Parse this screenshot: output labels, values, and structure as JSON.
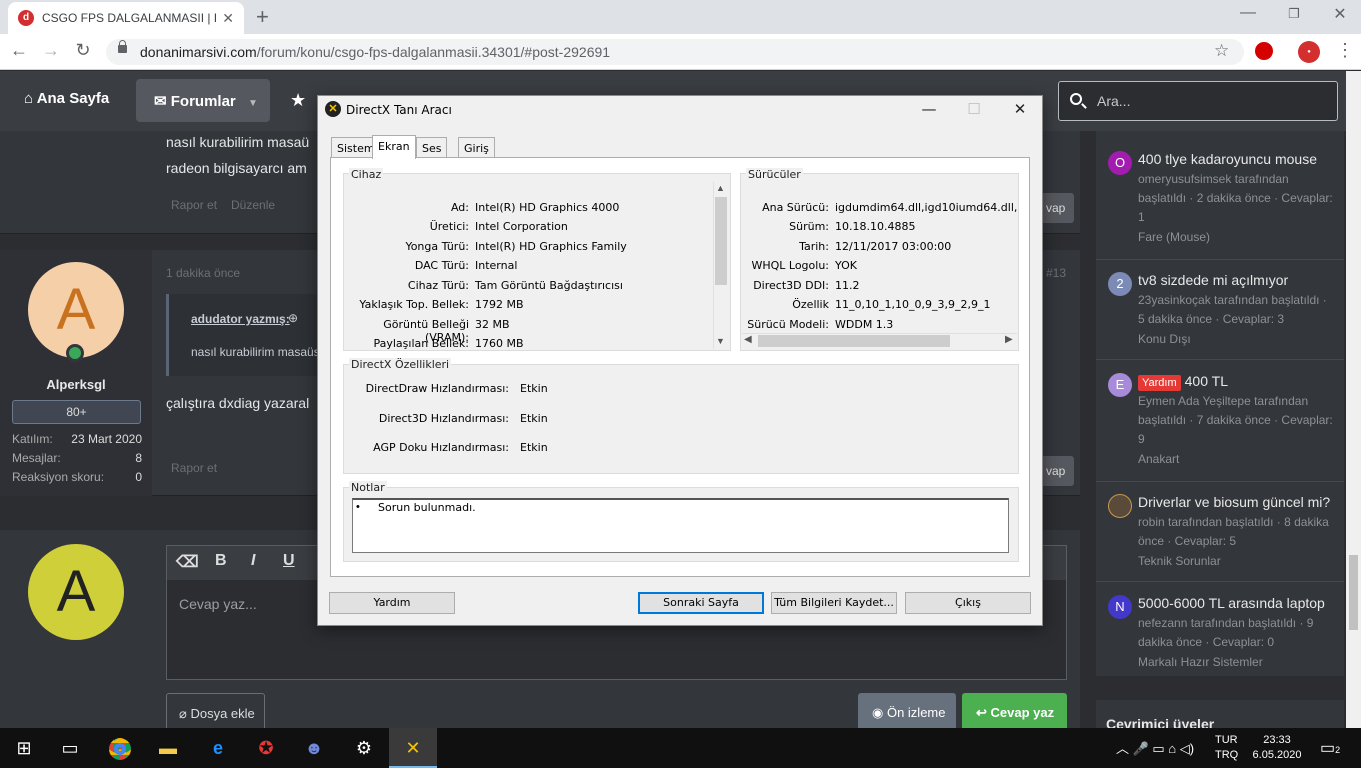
{
  "browser": {
    "tab_title": "CSGO FPS DALGALANMASII | Do",
    "url_host": "donanimarsivi.com",
    "url_path": "/forum/konu/csgo-fps-dalgalanmasii.34301/#post-292691"
  },
  "site_nav": {
    "home": "Ana Sayfa",
    "forums": "Forumlar",
    "search_placeholder": "Ara..."
  },
  "posts": {
    "post1": {
      "line1": "nasıl kurabilirim masaü",
      "line2": "radeon bilgisayarcı am",
      "report": "Rapor et",
      "edit": "Düzenle",
      "reply_btn": "vap"
    },
    "post2": {
      "time": "1 dakika önce",
      "number": "#13",
      "quote_author": "adudator yazmış:",
      "quote_text": "nasıl kurabilirim masaüs",
      "body": "çalıştıra dxdiag yazaral",
      "report": "Rapor et",
      "reply_btn": "vap"
    },
    "user": {
      "initial": "A",
      "name": "Alperksgl",
      "badge": "80+",
      "stats": [
        {
          "label": "Katılım:",
          "value": "23 Mart 2020"
        },
        {
          "label": "Mesajlar:",
          "value": "8"
        },
        {
          "label": "Reaksiyon skoru:",
          "value": "0"
        }
      ]
    },
    "reply_box": {
      "initial": "A",
      "placeholder": "Cevap yaz...",
      "attach": "Dosya ekle",
      "preview": "Ön izleme",
      "submit": "Cevap yaz"
    }
  },
  "sidebar": {
    "items": [
      {
        "initial": "O",
        "color": "#a21caf",
        "title": "400 tlye kadaroyuncu mouse",
        "sub": "omeryusufsimsek tarafından başlatıldı · 2 dakika önce · Cevaplar: 1",
        "cat": "Fare (Mouse)"
      },
      {
        "initial": "2",
        "color": "#7c8bb5",
        "title": "tv8 sizdede mi açılmıyor",
        "sub": "23yasinkoçak tarafından başlatıldı · 5 dakika önce · Cevaplar: 3",
        "cat": "Konu Dışı"
      },
      {
        "initial": "E",
        "color": "#a78bda",
        "tag": "Yardım",
        "title": "400 TL",
        "sub": "Eymen Ada Yeşiltepe tarafından başlatıldı · 7 dakika önce · Cevaplar: 9",
        "cat": "Anakart"
      },
      {
        "initial": "",
        "color": "#5a4a3a",
        "title": "Driverlar ve biosum güncel mi?",
        "sub": "robin tarafından başlatıldı · 8 dakika önce · Cevaplar: 5",
        "cat": "Teknik Sorunlar"
      },
      {
        "initial": "N",
        "color": "#4338ca",
        "title": "5000-6000 TL arasında laptop",
        "sub": "nefezann tarafından başlatıldı · 9 dakika önce · Cevaplar: 0",
        "cat": "Markalı Hazır Sistemler"
      }
    ],
    "online_title": "Çevrimiçi üyeler"
  },
  "dialog": {
    "title": "DirectX Tanı Aracı",
    "tabs": [
      "Sistem",
      "Ekran",
      "Ses",
      "Giriş"
    ],
    "device_label": "Cihaz",
    "device_rows": [
      {
        "label": "Ad:",
        "value": "Intel(R) HD Graphics 4000"
      },
      {
        "label": "Üretici:",
        "value": "Intel Corporation"
      },
      {
        "label": "Yonga Türü:",
        "value": "Intel(R) HD Graphics Family"
      },
      {
        "label": "DAC Türü:",
        "value": "Internal"
      },
      {
        "label": "Cihaz Türü:",
        "value": "Tam Görüntü Bağdaştırıcısı"
      },
      {
        "label": "Yaklaşık Top. Bellek:",
        "value": "1792 MB"
      },
      {
        "label": "Görüntü Belleği (VRAM):",
        "value": "32 MB"
      },
      {
        "label": "Paylaşılan Bellek:",
        "value": "1760 MB"
      }
    ],
    "drivers_label": "Sürücüler",
    "driver_rows": [
      {
        "label": "Ana Sürücü:",
        "value": "igdumdim64.dll,igd10iumd64.dll,igd10iu"
      },
      {
        "label": "Sürüm:",
        "value": "10.18.10.4885"
      },
      {
        "label": "Tarih:",
        "value": "12/11/2017 03:00:00"
      },
      {
        "label": "WHQL Logolu:",
        "value": "YOK"
      },
      {
        "label": "Direct3D DDI:",
        "value": "11.2"
      },
      {
        "label": "Özellik",
        "value": "11_0,10_1,10_0,9_3,9_2,9_1"
      },
      {
        "label": "Sürücü Modeli:",
        "value": "WDDM 1.3"
      }
    ],
    "features_label": "DirectX Özellikleri",
    "features": [
      {
        "label": "DirectDraw Hızlandırması:",
        "value": "Etkin"
      },
      {
        "label": "Direct3D Hızlandırması:",
        "value": "Etkin"
      },
      {
        "label": "AGP Doku Hızlandırması:",
        "value": "Etkin"
      }
    ],
    "notes_label": "Notlar",
    "notes_text": "Sorun bulunmadı.",
    "buttons": {
      "help": "Yardım",
      "next": "Sonraki Sayfa",
      "save": "Tüm Bilgileri Kaydet...",
      "exit": "Çıkış"
    }
  },
  "taskbar": {
    "lang1": "TUR",
    "lang2": "TRQ",
    "time": "23:33",
    "date": "6.05.2020",
    "notifications": "2"
  }
}
